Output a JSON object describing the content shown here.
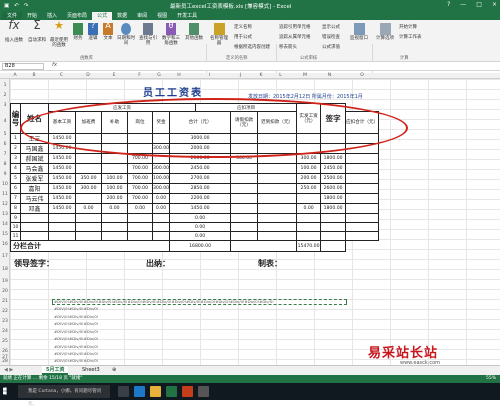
{
  "window": {
    "title": "最新员工excel工资表模板.xls [兼容模式] - Excel",
    "controls": [
      "?",
      "—",
      "□",
      "×"
    ]
  },
  "ribbon_tabs": [
    "文件",
    "开始",
    "插入",
    "页面布局",
    "公式",
    "数据",
    "审阅",
    "视图",
    "开发工具"
  ],
  "ribbon": {
    "insert_function": "插入函数",
    "autosum": "自动求和",
    "recent": "最近使用的函数",
    "financial": "财务",
    "logical": "逻辑",
    "text": "文本",
    "datetime": "日期和时间",
    "lookup": "查找与引用",
    "math": "数学和三角函数",
    "other": "其他函数",
    "name_manager": "名称管理器",
    "define_name": "定义名称",
    "use_in_formula": "用于公式",
    "create_from_selection": "根据所选内容创建",
    "trace_precedents": "追踪引用单元格",
    "trace_dependents": "追踪从属单元格",
    "remove_arrows": "移去箭头",
    "show_formulas": "显示公式",
    "error_checking": "错误检查",
    "evaluate": "公式求值",
    "watch": "监视窗口",
    "calc_options": "计算选项",
    "calc_now": "开始计算",
    "calc_sheet": "计算工作表",
    "group_library": "函数库",
    "group_names": "定义的名称",
    "group_audit": "公式审核",
    "group_calc": "计算"
  },
  "formula_bar": {
    "name_box": "B28",
    "fx": "fx"
  },
  "columns": [
    "A",
    "B",
    "C",
    "D",
    "E",
    "F",
    "G",
    "H",
    "I",
    "J",
    "K",
    "L",
    "M",
    "N",
    "O"
  ],
  "rows": [
    "1",
    "2",
    "3",
    "4",
    "5",
    "6",
    "7",
    "8",
    "9",
    "10",
    "11",
    "12",
    "13",
    "14",
    "15",
    "16",
    "17",
    "18",
    "19",
    "20",
    "21",
    "22",
    "23",
    "24",
    "25",
    "26",
    "27",
    "28"
  ],
  "sheet": {
    "title": "员工工资表",
    "dept_line": "发放日期：2015年2月12日  所属月份：2015年1月",
    "group_yingfa": "应发工资",
    "group_koujian": "应扣项目",
    "headers": {
      "num": "编号",
      "name": "姓名",
      "base": "基本工资",
      "overtime": "加班费",
      "subsidy": "补助",
      "post": "岗位",
      "bonus": "奖金",
      "total": "合计（元）",
      "deduct_leave": "请假扣款（元）",
      "late": "迟到扣款（元）",
      "other": "其它扣款（元）",
      "deduct_total": "应扣合计（元）",
      "actual": "实发工资（元）",
      "sign": "签字"
    },
    "rows": [
      {
        "num": "1",
        "name": "王三",
        "cells": [
          "1450.00",
          "",
          "",
          "",
          "",
          "3000.00",
          "",
          "",
          "",
          "",
          ""
        ]
      },
      {
        "num": "2",
        "name": "马国鑫",
        "cells": [
          "1450.00",
          "",
          "",
          "",
          "300.00",
          "2000.00",
          "",
          "",
          "",
          "",
          ""
        ]
      },
      {
        "num": "3",
        "name": "郝国斌",
        "cells": [
          "1450.00",
          "",
          "",
          "700.00",
          "",
          "2100.00",
          "300.00",
          "",
          "",
          "300.00",
          "1800.00"
        ]
      },
      {
        "num": "4",
        "name": "马会鑫",
        "cells": [
          "1450.00",
          "",
          "",
          "700.00",
          "300.00",
          "2450.00",
          "",
          "",
          "",
          "100.00",
          "2450.00"
        ]
      },
      {
        "num": "5",
        "name": "张爱军",
        "cells": [
          "1450.00",
          "350.00",
          "100.00",
          "700.00",
          "100.00",
          "2700.00",
          "",
          "",
          "",
          "200.00",
          "2500.00"
        ]
      },
      {
        "num": "6",
        "name": "嘉阳",
        "cells": [
          "1450.00",
          "300.00",
          "100.00",
          "700.00",
          "300.00",
          "2850.00",
          "",
          "",
          "",
          "250.00",
          "2600.00"
        ]
      },
      {
        "num": "7",
        "name": "马云伟",
        "cells": [
          "1450.00",
          "",
          "200.00",
          "700.00",
          "0.00",
          "2200.00",
          "",
          "",
          "",
          "",
          "1800.00"
        ]
      },
      {
        "num": "8",
        "name": "邓鑫",
        "cells": [
          "1450.00",
          "0.00",
          "0.00",
          "0.00",
          "0.00",
          "1450.00",
          "",
          "",
          "",
          "0.00",
          "1800.00"
        ]
      },
      {
        "num": "9",
        "name": "",
        "cells": [
          "",
          "",
          "",
          "",
          "",
          "0.00",
          "",
          "",
          "",
          "",
          ""
        ]
      },
      {
        "num": "10",
        "name": "",
        "cells": [
          "",
          "",
          "",
          "",
          "",
          "0.00",
          "",
          "",
          "",
          "",
          ""
        ]
      },
      {
        "num": "11",
        "name": "",
        "cells": [
          "",
          "",
          "",
          "",
          "",
          "0.00",
          "",
          "",
          "",
          "",
          ""
        ]
      }
    ],
    "subtotal_label": "分栏合计",
    "subtotal_total": "16800.00",
    "subtotal_actual": "15470.00",
    "sig_leader": "领导签字：",
    "sig_cashier": "出纳：",
    "sig_maker": "制表："
  },
  "overflow_text": "#DIV/0!#Div/0!#Div/0!#Div/0!#Div/0!#Div/0!#Div/0!#Div/0!#Div/0!#Div/0!#Div/0!#Div/0!#Div/0!#Div/0!#Div/0!",
  "overflow_text_short": "#DIV/0!#Div/0!#Div/0!",
  "sheet_tabs": {
    "active": "5月工资",
    "other": "Sheet3",
    "add": "⊕"
  },
  "status": {
    "left": "就绪 正在计算 ...  剩余 15/18 页  \"就绪\"",
    "zoom": "55%"
  },
  "taskbar": {
    "search": "我是 Cortana，小娜。有问题尽管问我。"
  },
  "watermark": {
    "text": "易采站长站",
    "url": "www.easck.com"
  },
  "colors": {
    "excel_green": "#217346",
    "title_blue": "#1f3f8f",
    "annotation_red": "#d0241b"
  }
}
